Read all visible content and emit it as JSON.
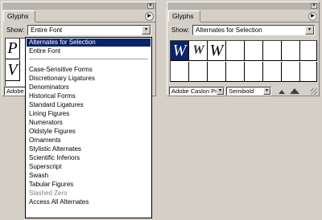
{
  "left_panel": {
    "tab_title": "Glyphs",
    "close_glyph": "×",
    "flyout_glyph": "▶",
    "show_label": "Show:",
    "show_value": "Entire Font",
    "dropdown_glyph": "▾",
    "glyphs": [
      "P",
      "V"
    ],
    "footer_font": "Adobe"
  },
  "right_panel": {
    "tab_title": "Glyphs",
    "close_glyph": "×",
    "flyout_glyph": "▶",
    "show_label": "Show:",
    "show_value": "Alternates for Selection",
    "dropdown_glyph": "▾",
    "glyphs": [
      "W",
      "W",
      "W"
    ],
    "footer_font": "Adobe Caslon Pr",
    "footer_style": "Semibold"
  },
  "menu": {
    "items": [
      {
        "label": "Alternates for Selection",
        "state": "highlight"
      },
      {
        "label": "Entire Font",
        "state": "normal"
      },
      {
        "separator": true
      },
      {
        "label": "Case-Sensitive Forms",
        "state": "normal"
      },
      {
        "label": "Discretionary Ligatures",
        "state": "normal"
      },
      {
        "label": "Denominators",
        "state": "normal"
      },
      {
        "label": "Historical Forms",
        "state": "normal"
      },
      {
        "label": "Standard Ligatures",
        "state": "normal"
      },
      {
        "label": "Lining Figures",
        "state": "normal"
      },
      {
        "label": "Numerators",
        "state": "normal"
      },
      {
        "label": "Oldstyle Figures",
        "state": "normal"
      },
      {
        "label": "Ornaments",
        "state": "normal"
      },
      {
        "label": "Stylistic Alternates",
        "state": "normal"
      },
      {
        "label": "Scientific Inferiors",
        "state": "normal"
      },
      {
        "label": "Superscript",
        "state": "normal"
      },
      {
        "label": "Swash",
        "state": "normal"
      },
      {
        "label": "Tabular Figures",
        "state": "normal"
      },
      {
        "label": "Slashed Zero",
        "state": "dim"
      },
      {
        "label": "Access All Alternates",
        "state": "normal"
      }
    ]
  },
  "colors": {
    "panel_bg": "#d4d0c8",
    "selection": "#0a246a",
    "menu_bg": "#ffffff"
  }
}
